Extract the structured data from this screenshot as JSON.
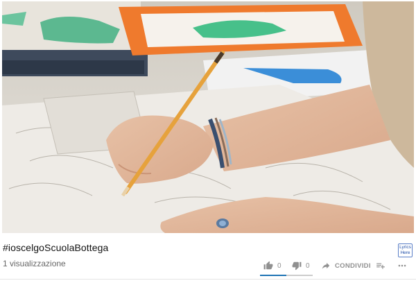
{
  "video": {
    "description_icon": "video-frame-drawing-hand"
  },
  "meta": {
    "title": "#ioscelgoScuolaBottega",
    "views": "1 visualizzazione"
  },
  "lyrics_badge": {
    "line1": "Lyrics",
    "line2": "Here"
  },
  "actions": {
    "like_icon": "thumb-up-icon",
    "like_count": "0",
    "dislike_icon": "thumb-down-icon",
    "dislike_count": "0",
    "share_icon": "share-arrow-icon",
    "share_label": "CONDIVIDI",
    "add_icon": "playlist-add-icon",
    "more_icon": "more-dots-icon"
  },
  "sentiment": {
    "like_fraction": 0.5
  },
  "colors": {
    "accent": "#1e73b4",
    "muted": "#909090",
    "text": "#111111"
  }
}
